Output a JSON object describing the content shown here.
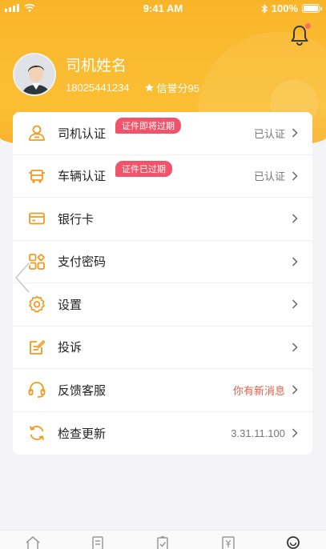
{
  "status_bar": {
    "time": "9:41 AM",
    "battery": "100%"
  },
  "profile": {
    "name": "司机姓名",
    "phone": "18025441234",
    "credit": "信誉分95"
  },
  "menu": [
    {
      "label": "司机认证",
      "badge": "证件即将过期",
      "status": "已认证",
      "icon": "driver-icon"
    },
    {
      "label": "车辆认证",
      "badge": "证件已过期",
      "status": "已认证",
      "icon": "vehicle-icon"
    },
    {
      "label": "银行卡",
      "badge": "",
      "status": "",
      "icon": "bank-card-icon"
    },
    {
      "label": "支付密码",
      "badge": "",
      "status": "",
      "icon": "password-grid-icon"
    },
    {
      "label": "设置",
      "badge": "",
      "status": "",
      "icon": "gear-icon"
    },
    {
      "label": "投诉",
      "badge": "",
      "status": "",
      "icon": "complaint-icon"
    },
    {
      "label": "反馈客服",
      "badge": "",
      "status": "你有新消息",
      "icon": "headset-icon"
    },
    {
      "label": "检查更新",
      "badge": "",
      "status": "3.31.11.100",
      "icon": "refresh-icon"
    }
  ],
  "colors": {
    "accent": "#f9b52a",
    "icon": "#f39a1e",
    "badge": "#f0546a",
    "alert_text": "#e85d4a"
  },
  "tabbar": [
    "home-icon",
    "orders-icon",
    "tasks-icon",
    "wallet-icon",
    "profile-icon"
  ]
}
